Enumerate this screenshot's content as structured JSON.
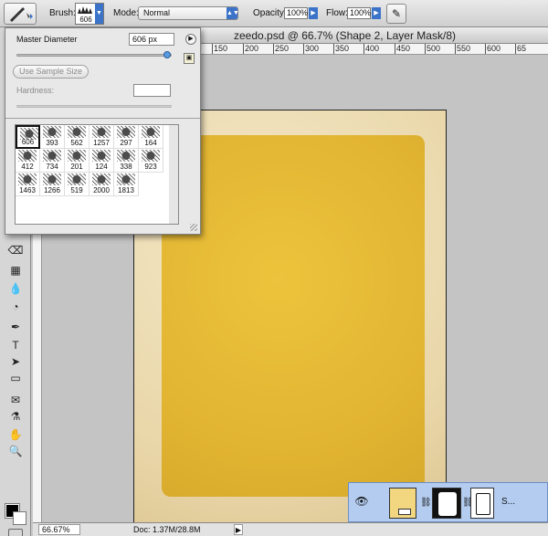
{
  "options_bar": {
    "brush_label": "Brush:",
    "brush_size": "606",
    "mode_label": "Mode:",
    "mode_value": "Normal",
    "opacity_label": "Opacity:",
    "opacity_value": "100%",
    "flow_label": "Flow:",
    "flow_value": "100%",
    "icons": [
      "brush-icon",
      "airbrush-icon"
    ]
  },
  "document": {
    "title": "zeedo.psd @ 66.7% (Shape 2, Layer Mask/8)",
    "ruler_ticks": [
      "150",
      "200",
      "250",
      "300",
      "350",
      "400",
      "450",
      "500",
      "550",
      "600",
      "65"
    ],
    "zoom": "66.67%",
    "doc_info": "Doc: 1.37M/28.8M"
  },
  "brush_panel": {
    "master_diameter_label": "Master Diameter",
    "master_diameter_value": "606 px",
    "use_sample_size_label": "Use Sample Size",
    "hardness_label": "Hardness:",
    "hardness_value": "",
    "master_diameter_level": 0.97,
    "presets": [
      "606",
      "393",
      "562",
      "1257",
      "297",
      "164",
      "412",
      "734",
      "201",
      "124",
      "338",
      "923",
      "1463",
      "1266",
      "519",
      "2000",
      "1813"
    ],
    "selected_preset": "606"
  },
  "layer": {
    "name": "S..."
  },
  "colors": {
    "selection_blue": "#3b73c9",
    "paper": "#efe0bb",
    "grunge_yellow": "#e2b532",
    "layer_highlight": "#b3ccf0"
  }
}
